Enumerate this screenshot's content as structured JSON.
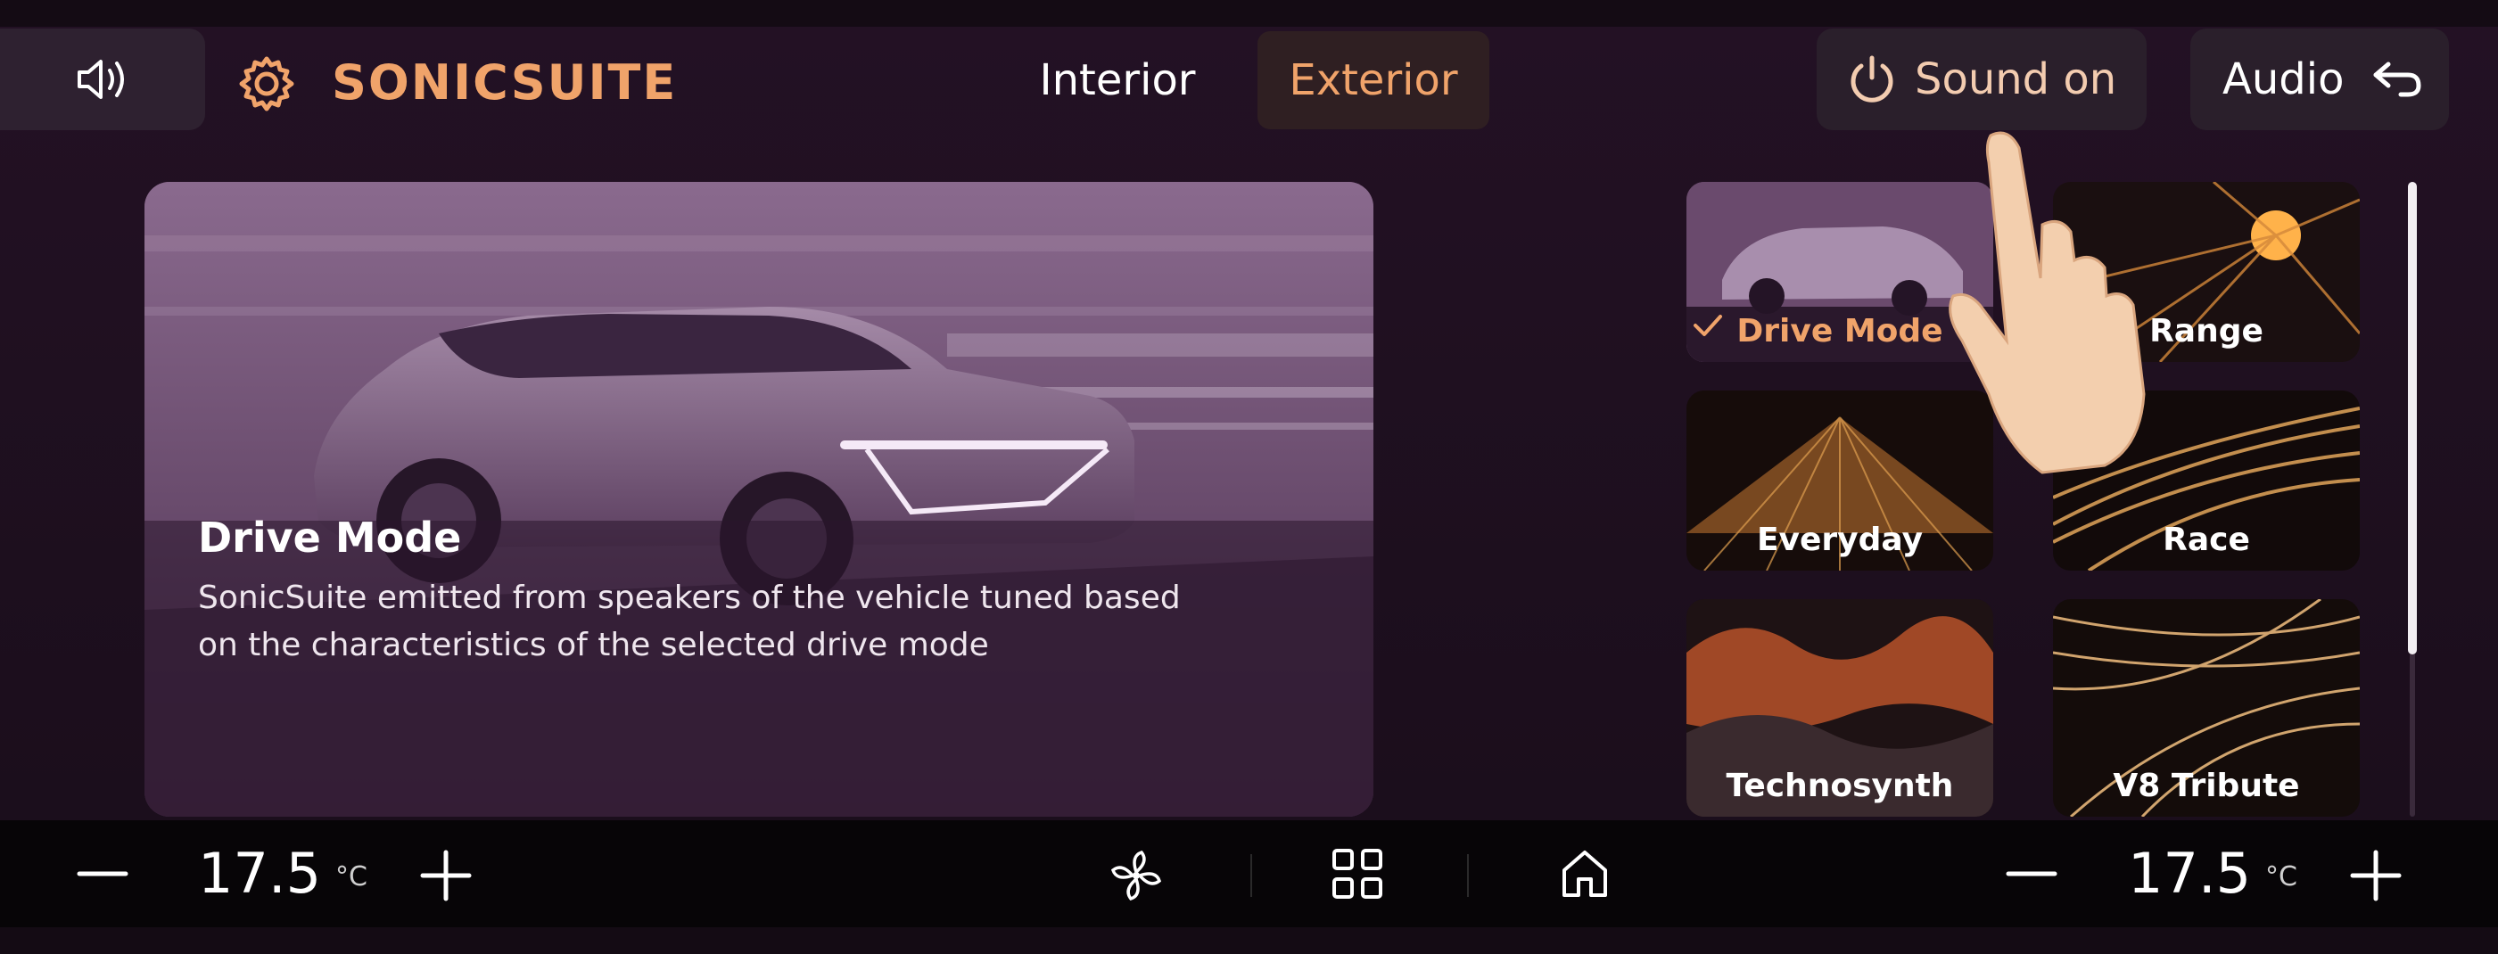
{
  "header": {
    "brand_title": "SONICSUITE",
    "tabs": [
      {
        "label": "Interior",
        "selected": false
      },
      {
        "label": "Exterior",
        "selected": true
      }
    ],
    "sound_button_label": "Sound on",
    "audio_button_label": "Audio"
  },
  "hero": {
    "title": "Drive Mode",
    "description": "SonicSuite emitted from speakers of the vehicle tuned based on the characteristics of the selected drive mode"
  },
  "sound_modes": [
    {
      "label": "Drive Mode",
      "selected": true
    },
    {
      "label": "Range",
      "selected": false
    },
    {
      "label": "Everyday",
      "selected": false
    },
    {
      "label": "Race",
      "selected": false
    },
    {
      "label": "Technosynth",
      "selected": false
    },
    {
      "label": "V8 Tribute",
      "selected": false
    }
  ],
  "climate": {
    "left_temp": "17.5",
    "right_temp": "17.5",
    "unit": "°C"
  },
  "icons": {
    "volume": "speaker-volume-icon",
    "settings": "gear-icon",
    "power": "power-icon",
    "back": "back-arrow-icon",
    "fan": "fan-icon",
    "apps": "grid-icon",
    "home": "home-icon"
  },
  "colors": {
    "accent": "#f0a36a",
    "background": "#1d0f1e",
    "bottom_bar": "#070507"
  }
}
